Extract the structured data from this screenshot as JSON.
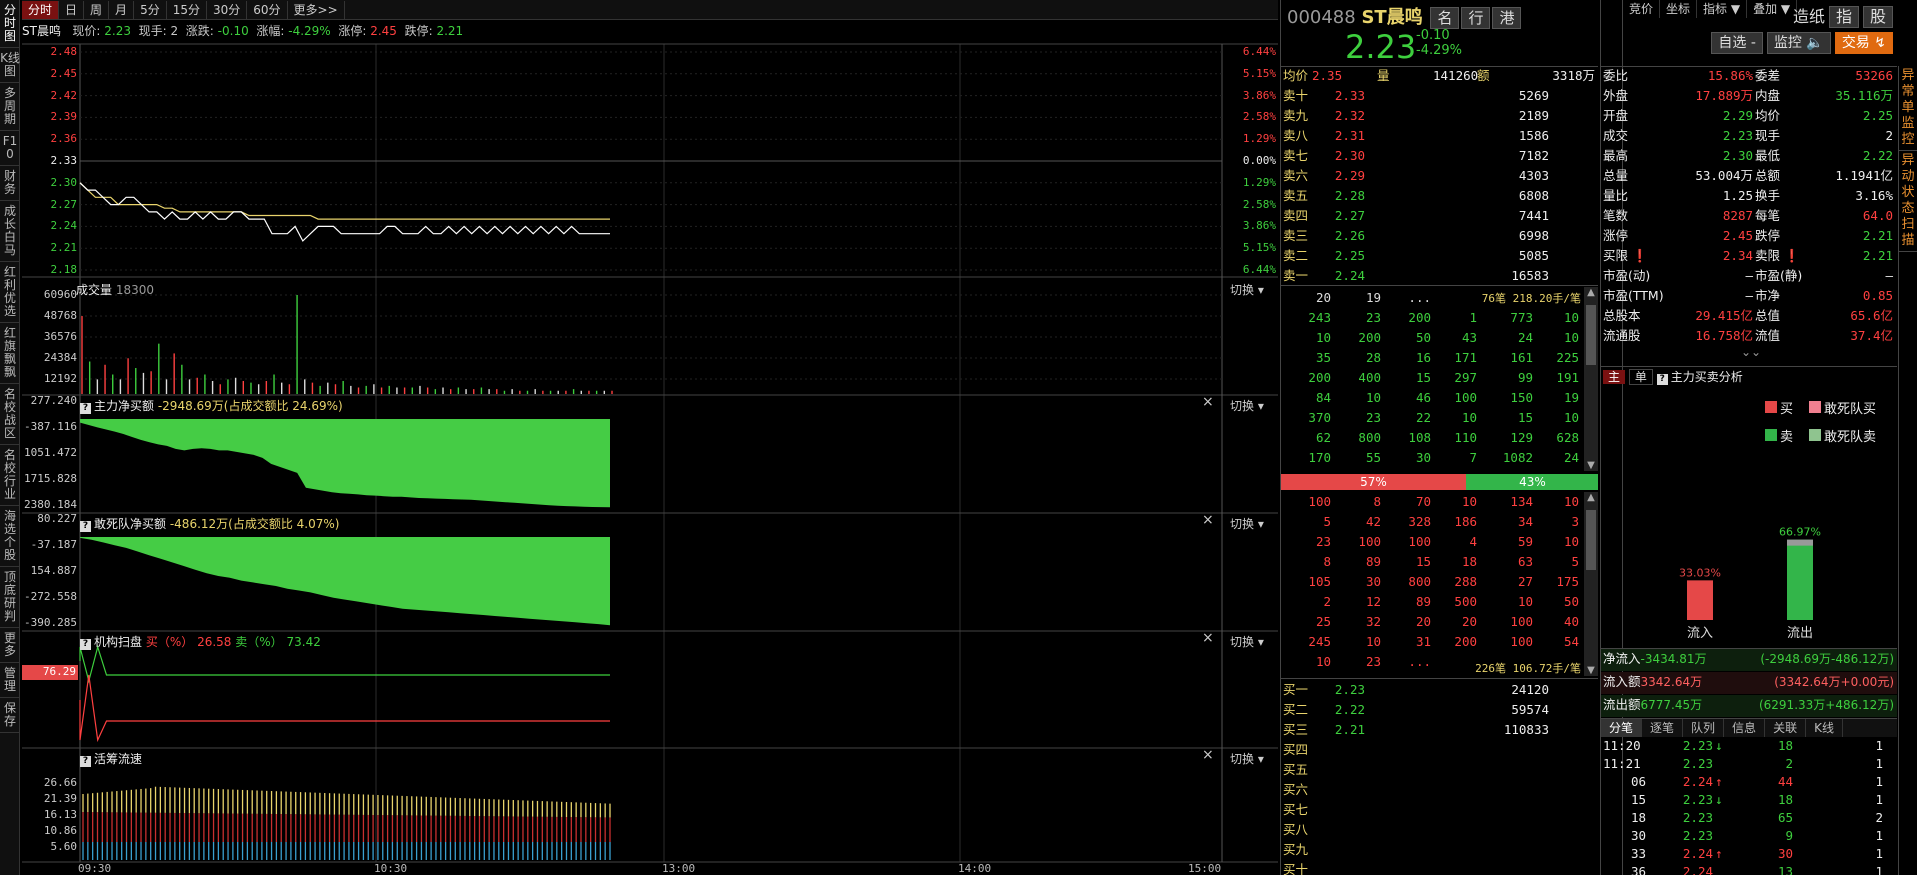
{
  "left_tabs": [
    "分时图",
    "K线图",
    "多周期",
    "F10",
    "财务",
    "成长白马",
    "红利优选",
    "红旗飘飘",
    "名校战区",
    "名校行业",
    "海选个股",
    "顶底研判",
    "更多",
    "管理",
    "保存"
  ],
  "toolbar": {
    "periods": [
      "分时",
      "日",
      "周",
      "月",
      "5分",
      "15分",
      "30分",
      "60分",
      "更多>>"
    ],
    "right": [
      "竞价",
      "坐标",
      "指标 ▼",
      "叠加 ▼"
    ]
  },
  "info": {
    "name": "ST晨鸣",
    "price_label": "现价:",
    "price": "2.23",
    "hand_label": "现手:",
    "hand": "2",
    "chg_label": "涨跌:",
    "chg": "-0.10",
    "pct_label": "涨幅:",
    "pct": "-4.29%",
    "up_label": "涨停:",
    "up": "2.45",
    "down_label": "跌停:",
    "down": "2.21"
  },
  "price_panel": {
    "left_ticks": [
      {
        "v": "2.48",
        "c": "red"
      },
      {
        "v": "2.45",
        "c": "red"
      },
      {
        "v": "2.42",
        "c": "red"
      },
      {
        "v": "2.39",
        "c": "red"
      },
      {
        "v": "2.36",
        "c": "red"
      },
      {
        "v": "2.33",
        "c": "white"
      },
      {
        "v": "2.30",
        "c": "green"
      },
      {
        "v": "2.27",
        "c": "green"
      },
      {
        "v": "2.24",
        "c": "green"
      },
      {
        "v": "2.21",
        "c": "green"
      },
      {
        "v": "2.18",
        "c": "green"
      }
    ],
    "right_ticks": [
      {
        "v": "6.44%",
        "c": "red"
      },
      {
        "v": "5.15%",
        "c": "red"
      },
      {
        "v": "3.86%",
        "c": "red"
      },
      {
        "v": "2.58%",
        "c": "red"
      },
      {
        "v": "1.29%",
        "c": "red"
      },
      {
        "v": "0.00%",
        "c": "white"
      },
      {
        "v": "1.29%",
        "c": "green"
      },
      {
        "v": "2.58%",
        "c": "green"
      },
      {
        "v": "3.86%",
        "c": "green"
      },
      {
        "v": "5.15%",
        "c": "green"
      },
      {
        "v": "6.44%",
        "c": "green"
      }
    ],
    "price_line": [
      2.3,
      2.29,
      2.29,
      2.28,
      2.27,
      2.27,
      2.28,
      2.28,
      2.27,
      2.26,
      2.26,
      2.25,
      2.26,
      2.25,
      2.25,
      2.26,
      2.25,
      2.26,
      2.25,
      2.25,
      2.26,
      2.26,
      2.25,
      2.25,
      2.25,
      2.23,
      2.23,
      2.23,
      2.24,
      2.22,
      2.23,
      2.24,
      2.24,
      2.24,
      2.23,
      2.23,
      2.23,
      2.23,
      2.23,
      2.23,
      2.24,
      2.24,
      2.23,
      2.23,
      2.23,
      2.24,
      2.23,
      2.23,
      2.24,
      2.23,
      2.24,
      2.23,
      2.24,
      2.23,
      2.24,
      2.23,
      2.24,
      2.23,
      2.24,
      2.23,
      2.24,
      2.23,
      2.24,
      2.23,
      2.24,
      2.23,
      2.23,
      2.23,
      2.23,
      2.23
    ],
    "avg_line": [
      2.3,
      2.29,
      2.28,
      2.28,
      2.28,
      2.27,
      2.27,
      2.27,
      2.27,
      2.27,
      2.27,
      2.265,
      2.265,
      2.26,
      2.26,
      2.26,
      2.26,
      2.26,
      2.26,
      2.26,
      2.26,
      2.26,
      2.255,
      2.255,
      2.255,
      2.255,
      2.255,
      2.255,
      2.255,
      2.255,
      2.255,
      2.25,
      2.25,
      2.25,
      2.25,
      2.25,
      2.25,
      2.25,
      2.25,
      2.25,
      2.25,
      2.25,
      2.25,
      2.25,
      2.25,
      2.25,
      2.25,
      2.25,
      2.25,
      2.25,
      2.25,
      2.25,
      2.25,
      2.25,
      2.25,
      2.25,
      2.25,
      2.25,
      2.25,
      2.25,
      2.25,
      2.25,
      2.25,
      2.25,
      2.25,
      2.25,
      2.25,
      2.25,
      2.25,
      2.25
    ]
  },
  "chart_data": [
    {
      "type": "bar",
      "title": "成交量",
      "value_label": "18300",
      "y_ticks": [
        "60960",
        "48768",
        "36576",
        "24384",
        "12192"
      ],
      "ylim": [
        0,
        60960
      ],
      "values": [
        48000,
        20000,
        9000,
        18000,
        12000,
        9000,
        22000,
        16000,
        13000,
        14000,
        31000,
        9000,
        25000,
        18000,
        9000,
        10000,
        12000,
        8000,
        6000,
        9000,
        10000,
        8000,
        7000,
        6000,
        8000,
        12000,
        7000,
        6000,
        60960,
        9000,
        7000,
        5000,
        7000,
        6000,
        8000,
        5000,
        4000,
        5000,
        6000,
        4000,
        5000,
        4000,
        4000,
        4000,
        5000,
        4000,
        3000,
        4000,
        3000,
        4000,
        3000,
        3000,
        4000,
        3000,
        3000,
        2000,
        3000,
        2000,
        2000,
        3000,
        2000,
        2000,
        2000,
        2000,
        3000,
        2000,
        2000,
        2000,
        2000,
        2000
      ]
    },
    {
      "type": "area",
      "title": "主力净买额",
      "value_label": "-2948.69万(占成交额比 24.69%)",
      "y_ticks": [
        "277.240",
        "-387.116",
        "1051.472",
        "1715.828",
        "2380.184"
      ],
      "values": [
        -120,
        -200,
        -280,
        -350,
        -420,
        -500,
        -600,
        -700,
        -780,
        -850,
        -900,
        -1000,
        -1050,
        -1000,
        -980,
        -1000,
        -1050,
        -1050,
        -1100,
        -1150,
        -1200,
        -1300,
        -1500,
        -1600,
        -1700,
        -1800,
        -2300,
        -2350,
        -2400,
        -2450,
        -2480,
        -2500,
        -2520,
        -2550,
        -2560,
        -2580,
        -2600,
        -2600,
        -2620,
        -2640,
        -2650,
        -2660,
        -2670,
        -2680,
        -2690,
        -2700,
        -2720,
        -2740,
        -2760,
        -2780,
        -2800,
        -2820,
        -2840,
        -2860,
        -2880,
        -2900,
        -2910,
        -2920,
        -2930,
        -2940,
        -2945,
        -2948.69
      ]
    },
    {
      "type": "area",
      "title": "敢死队净买额",
      "value_label": "-486.12万(占成交额比 4.07%)",
      "y_ticks": [
        "80.227",
        "-37.187",
        "154.887",
        "-272.558",
        "-390.285"
      ],
      "values": [
        -5,
        -15,
        -30,
        -45,
        -60,
        -80,
        -100,
        -120,
        -140,
        -160,
        -180,
        -200,
        -215,
        -225,
        -240,
        -250,
        -260,
        -270,
        -285,
        -295,
        -305,
        -320,
        -335,
        -345,
        -355,
        -365,
        -375,
        -385,
        -395,
        -400,
        -405,
        -410,
        -415,
        -420,
        -425,
        -430,
        -435,
        -440,
        -445,
        -450,
        -455,
        -460,
        -465,
        -470,
        -475,
        -480,
        -486.12
      ]
    },
    {
      "type": "line",
      "title": "机构扫盘",
      "buy_label": "买（%）",
      "buy": "26.58",
      "sell_label": "卖（%）",
      "sell": "73.42",
      "tag": "76.29"
    },
    {
      "type": "bar",
      "title": "活筹流速",
      "y_ticks": [
        "26.66",
        "21.39",
        "16.13",
        "10.86",
        "5.60"
      ]
    }
  ],
  "x_ticks": [
    "09:30",
    "10:30",
    "13:00",
    "14:00",
    "15:00"
  ],
  "ui": {
    "switch": "切换 ▾",
    "close": "×"
  },
  "quote": {
    "code": "000488",
    "name": "ST晨鸣",
    "tags": [
      "名",
      "行",
      "港"
    ],
    "price": "2.23",
    "chg": "-0.10",
    "pct": "-4.29%",
    "btns": [
      "造纸",
      "指",
      "股"
    ],
    "ops": [
      "自选 -",
      "监控 🔈",
      "交易 ↯"
    ]
  },
  "stat": {
    "avg_label": "均价",
    "avg": "2.35",
    "vol_label": "量",
    "vol": "141260",
    "amt_label": "额",
    "amt": "3318万"
  },
  "asks": [
    [
      "卖十",
      "2.33",
      "5269"
    ],
    [
      "卖九",
      "2.32",
      "2189"
    ],
    [
      "卖八",
      "2.31",
      "1586"
    ],
    [
      "卖七",
      "2.30",
      "7182"
    ],
    [
      "卖六",
      "2.29",
      "4303"
    ],
    [
      "卖五",
      "2.28",
      "6808"
    ],
    [
      "卖四",
      "2.27",
      "7441"
    ],
    [
      "卖三",
      "2.26",
      "6998"
    ],
    [
      "卖二",
      "2.25",
      "5085"
    ],
    [
      "卖一",
      "2.24",
      "16583"
    ]
  ],
  "ask_queue": {
    "summary": "76笔 218.20手/笔",
    "rows": [
      [
        "20",
        "19",
        "...",
        "",
        "",
        ""
      ],
      [
        "243",
        "23",
        "200",
        "1",
        "773",
        "10"
      ],
      [
        "10",
        "200",
        "50",
        "43",
        "24",
        "10"
      ],
      [
        "35",
        "28",
        "16",
        "171",
        "161",
        "225"
      ],
      [
        "200",
        "400",
        "15",
        "297",
        "99",
        "191"
      ],
      [
        "84",
        "10",
        "46",
        "100",
        "150",
        "19"
      ],
      [
        "370",
        "23",
        "22",
        "10",
        "15",
        "10"
      ],
      [
        "62",
        "800",
        "108",
        "110",
        "129",
        "628"
      ],
      [
        "170",
        "55",
        "30",
        "7",
        "1082",
        "24"
      ]
    ]
  },
  "ratio": {
    "buy": "57%",
    "sell": "43%"
  },
  "bid_queue": {
    "summary": "226笔 106.72手/笔",
    "rows": [
      [
        "100",
        "8",
        "70",
        "10",
        "134",
        "10"
      ],
      [
        "5",
        "42",
        "328",
        "186",
        "34",
        "3"
      ],
      [
        "23",
        "100",
        "100",
        "4",
        "59",
        "10"
      ],
      [
        "8",
        "89",
        "15",
        "18",
        "63",
        "5"
      ],
      [
        "105",
        "30",
        "800",
        "288",
        "27",
        "175"
      ],
      [
        "2",
        "12",
        "89",
        "500",
        "10",
        "50"
      ],
      [
        "25",
        "32",
        "20",
        "20",
        "100",
        "40"
      ],
      [
        "245",
        "10",
        "31",
        "200",
        "100",
        "54"
      ],
      [
        "10",
        "23",
        "...",
        "",
        "",
        ""
      ]
    ]
  },
  "bids": [
    [
      "买一",
      "2.23",
      "24120"
    ],
    [
      "买二",
      "2.22",
      "59574"
    ],
    [
      "买三",
      "2.21",
      "110833"
    ],
    [
      "买四",
      "",
      ""
    ],
    [
      "买五",
      "",
      ""
    ],
    [
      "买六",
      "",
      ""
    ],
    [
      "买七",
      "",
      ""
    ],
    [
      "买八",
      "",
      ""
    ],
    [
      "买九",
      "",
      ""
    ],
    [
      "买十",
      "",
      ""
    ]
  ],
  "stats": [
    [
      "委比",
      "15.86%",
      "委差",
      "53266"
    ],
    [
      "外盘",
      "17.889万",
      "内盘",
      "35.116万"
    ],
    [
      "开盘",
      "2.29",
      "均价",
      "2.25"
    ],
    [
      "成交",
      "2.23",
      "现手",
      "2"
    ],
    [
      "最高",
      "2.30",
      "最低",
      "2.22"
    ],
    [
      "总量",
      "53.004万",
      "总额",
      "1.1941亿"
    ],
    [
      "量比",
      "1.25",
      "换手",
      "3.16%"
    ],
    [
      "笔数",
      "8287",
      "每笔",
      "64.0"
    ],
    [
      "涨停",
      "2.45",
      "跌停",
      "2.21"
    ],
    [
      "买限 ❗",
      "2.34",
      "卖限 ❗",
      "2.21"
    ],
    [
      "市盈(动)",
      "—",
      "市盈(静)",
      "—"
    ],
    [
      "市盈(TTM)",
      "—",
      "市净",
      "0.85"
    ],
    [
      "总股本",
      "29.415亿",
      "总值",
      "65.6亿"
    ],
    [
      "流通股",
      "16.758亿",
      "流值",
      "37.4亿"
    ]
  ],
  "flow": {
    "tab1": "主",
    "tab2": "单",
    "title": "主力买卖分析",
    "legend": [
      "买",
      "敢死队买",
      "卖",
      "敢死队卖"
    ],
    "in_pct": "33.03%",
    "out_pct": "66.97%",
    "in_label": "流入",
    "out_label": "流出",
    "in_frac": 0.3303,
    "out_frac": 0.6697
  },
  "netrows": [
    [
      "净流入",
      "-3434.81万",
      "(-2948.69万-486.12万)"
    ],
    [
      "流入额",
      "3342.64万",
      "(3342.64万+0.00元)"
    ],
    [
      "流出额",
      "6777.45万",
      "(6291.33万+486.12万)"
    ]
  ],
  "tick_tabs": [
    "分笔",
    "逐笔",
    "队列",
    "信息",
    "关联",
    "K线"
  ],
  "ticks": [
    [
      "11:20",
      "2.23",
      "↓",
      "18",
      "1"
    ],
    [
      "11:21",
      "2.23",
      "",
      "2",
      "1"
    ],
    [
      "06",
      "2.24",
      "↑",
      "44",
      "1"
    ],
    [
      "15",
      "2.23",
      "↓",
      "18",
      "1"
    ],
    [
      "18",
      "2.23",
      "",
      "65",
      "2"
    ],
    [
      "30",
      "2.23",
      "",
      "9",
      "1"
    ],
    [
      "33",
      "2.24",
      "↑",
      "30",
      "1"
    ],
    [
      "36",
      "2.24",
      "",
      "13",
      "1"
    ]
  ],
  "farright": [
    "异常单监控",
    "异动状态扫描"
  ]
}
